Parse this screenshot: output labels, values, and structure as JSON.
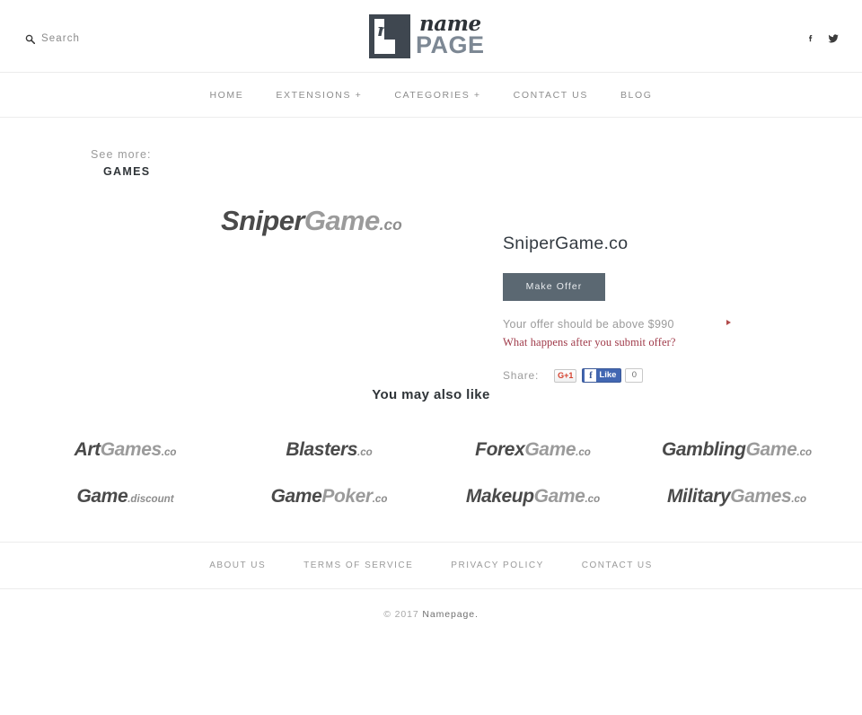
{
  "header": {
    "search": {
      "label": "Search",
      "icon": "search-icon"
    },
    "logo": {
      "mark_letter": "n",
      "name": "name",
      "page": "PAGE"
    },
    "social": [
      {
        "name": "facebook-icon",
        "label": "f"
      },
      {
        "name": "twitter-icon",
        "label": "t"
      }
    ]
  },
  "nav": {
    "items": [
      {
        "label": "HOME"
      },
      {
        "label": "EXTENSIONS +"
      },
      {
        "label": "CATEGORIES +"
      },
      {
        "label": "CONTACT US"
      },
      {
        "label": "BLOG"
      }
    ]
  },
  "seemore": {
    "label": "See more:",
    "category": "GAMES"
  },
  "hero": {
    "domain_logo": {
      "dark": "Sniper",
      "light": "Game",
      "tld": ".co"
    },
    "domain_title": "SniperGame.co",
    "make_offer_label": "Make Offer",
    "offer_note": "Your offer should be above $990",
    "offer_min_price": "$990",
    "offer_note_prefix": "Your offer should be above",
    "offer_link": "What happens after you submit offer?",
    "share": {
      "label": "Share:",
      "gplus_label": "G+1",
      "fb_f": "f",
      "fb_like_label": "Like",
      "fb_count": "0"
    }
  },
  "also_like": {
    "title": "You may also like",
    "rows": [
      [
        {
          "dark": "Art",
          "light": "Games",
          "tld": ".co",
          "full": "ArtGames.co"
        },
        {
          "dark": "Blasters",
          "light": "",
          "tld": ".co",
          "full": "Blasters.co"
        },
        {
          "dark": "Forex",
          "light": "Game",
          "tld": ".co",
          "full": "ForexGame.co"
        },
        {
          "dark": "Gambling",
          "light": "Game",
          "tld": ".co",
          "full": "GamblingGame.co"
        }
      ],
      [
        {
          "dark": "Game",
          "light": "",
          "tld": ".discount",
          "full": "Game.discount"
        },
        {
          "dark": "Game",
          "light": "Poker",
          "tld": ".co",
          "full": "GamePoker.co"
        },
        {
          "dark": "Makeup",
          "light": "Game",
          "tld": ".co",
          "full": "MakeupGame.co"
        },
        {
          "dark": "Military",
          "light": "Games",
          "tld": ".co",
          "full": "MilitaryGames.co"
        }
      ]
    ]
  },
  "footer": {
    "links": [
      {
        "label": "ABOUT US"
      },
      {
        "label": "TERMS OF SERVICE"
      },
      {
        "label": "PRIVACY POLICY"
      },
      {
        "label": "CONTACT US"
      }
    ],
    "copyright_prefix": "© 2017 ",
    "copyright_brand": "Namepage."
  },
  "colors": {
    "accent_button": "#5b6872",
    "link_maroon": "#a03b4a",
    "logo_page": "#7d8894",
    "text_muted": "#9b9b9b",
    "facebook_blue": "#4267b2",
    "gplus_red": "#d5422f"
  }
}
